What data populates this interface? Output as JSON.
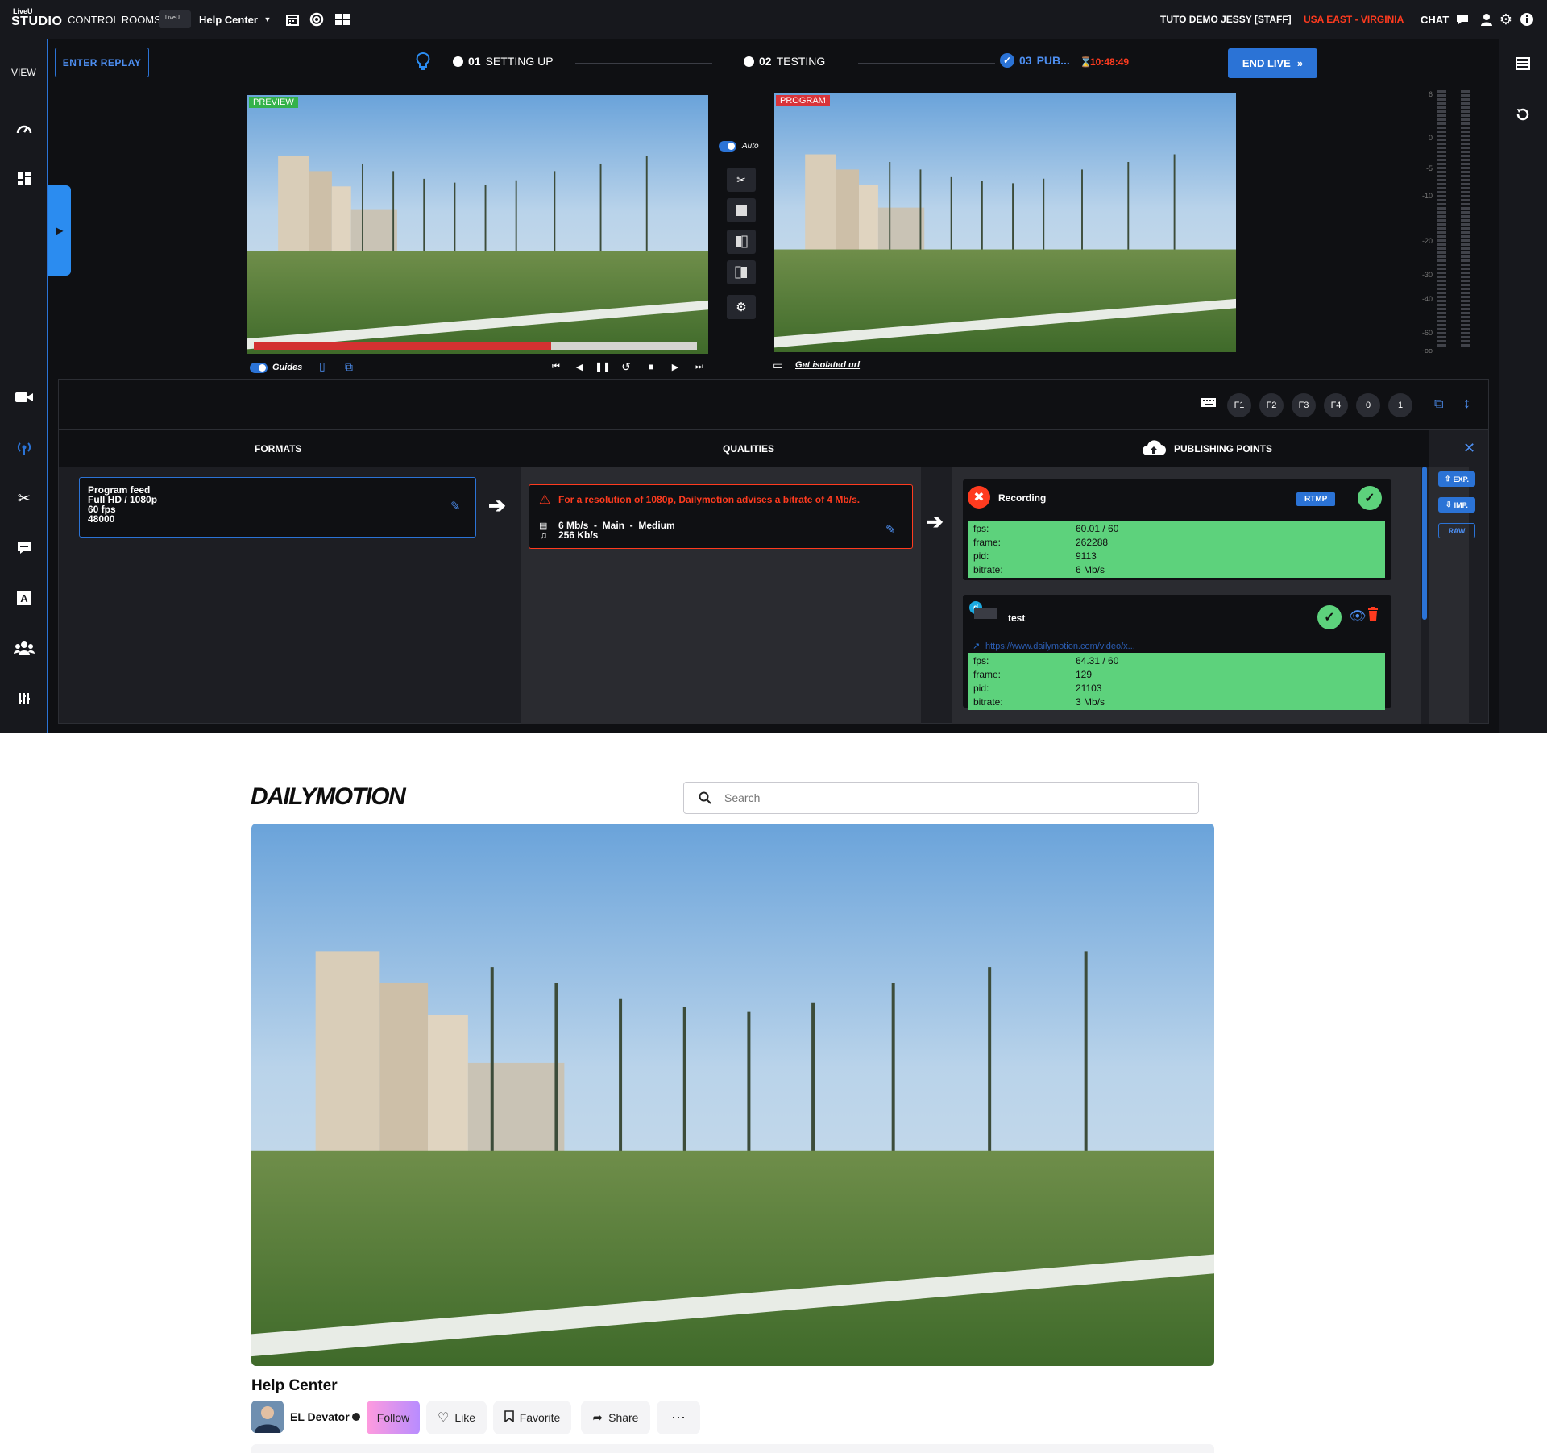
{
  "studio": {
    "logo_top": "LiveU",
    "logo_bottom": "STUDIO",
    "menu": {
      "control_rooms": "CONTROL ROOMS",
      "room": "Help Center",
      "chip": "LiveU"
    },
    "user": "TUTO DEMO JESSY [STAFF]",
    "region": "USA EAST - VIRGINIA",
    "chat": "CHAT",
    "view": "VIEW",
    "enter_replay": "ENTER REPLAY",
    "steps": [
      {
        "num": "01",
        "label": "SETTING UP"
      },
      {
        "num": "02",
        "label": "TESTING"
      },
      {
        "num": "03",
        "label": "PUB..."
      }
    ],
    "timer": "10:48:49",
    "end_live": "END LIVE",
    "preview_label": "PREVIEW",
    "program_label": "PROGRAM",
    "auto_label": "Auto",
    "guides_label": "Guides",
    "isolated_url": "Get isolated url",
    "progress": 0.67,
    "meter_ticks": [
      "6",
      "0",
      "-5",
      "-10",
      "-20",
      "-30",
      "-40",
      "-60",
      "-oo"
    ],
    "fkeys": [
      "F1",
      "F2",
      "F3",
      "F4",
      "0",
      "1"
    ],
    "panel": {
      "formats_title": "FORMATS",
      "qualities_title": "QUALITIES",
      "publishing_title": "PUBLISHING POINTS",
      "format_card": {
        "line1": "Program feed",
        "line2": "Full HD / 1080p",
        "line3": "60 fps",
        "line4": "48000"
      },
      "warning": "For a resolution of 1080p, Dailymotion advises a bitrate of 4 Mb/s.",
      "quality_video": "6 Mb/s  -  Main  -  Medium",
      "quality_audio": "256 Kb/s",
      "points": [
        {
          "name": "Recording",
          "badge": "RTMP",
          "stats": [
            [
              "fps:",
              "60.01 / 60"
            ],
            [
              "frame:",
              "262288"
            ],
            [
              "pid:",
              "9113"
            ],
            [
              "bitrate:",
              "6 Mb/s"
            ]
          ]
        },
        {
          "name": "test",
          "link": "https://www.dailymotion.com/video/x...",
          "stats": [
            [
              "fps:",
              "64.31 / 60"
            ],
            [
              "frame:",
              "129"
            ],
            [
              "pid:",
              "21103"
            ],
            [
              "bitrate:",
              "3 Mb/s"
            ]
          ]
        }
      ],
      "side_buttons": {
        "exp": "EXP.",
        "imp": "IMP.",
        "raw": "RAW"
      }
    },
    "colors": {
      "accent": "#2b73d6",
      "alert": "#ff3b1f",
      "ok": "#5dd27c",
      "preview": "#34b24a",
      "program": "#d9343a"
    }
  },
  "dailymotion": {
    "logo": "DAILYMOTION",
    "search_placeholder": "Search",
    "video_title": "Help Center",
    "channel": "EL Devator",
    "follow": "Follow",
    "like": "Like",
    "favorite": "Favorite",
    "share": "Share",
    "more": "⋯"
  }
}
